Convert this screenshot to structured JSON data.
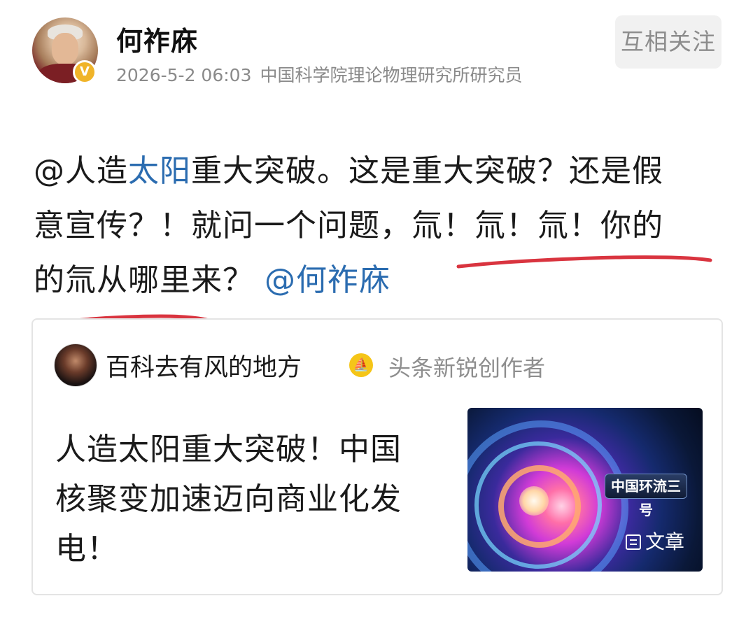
{
  "post": {
    "author_name": "何祚庥",
    "verified_badge": "V",
    "timestamp": "2026-5-2 06:03",
    "author_title": "中国科学院理论物理研究所研究员",
    "follow_label": "互相关注",
    "text": {
      "line1_prefix": "@人造",
      "line1_link": "太阳",
      "line1_suffix": "重大突破。这是重大突破？还是假",
      "line2": "意宣传？！就问一个问题，氚！氚！氚！你的",
      "line3_text": "的氚从哪里来？",
      "line3_mention": "@何祚庥"
    },
    "annotation_color": "#d9343f"
  },
  "repost": {
    "author_name": "百科去有风的地方",
    "creator_badge_icon": "sail-icon",
    "creator_title": "头条新锐创作者",
    "title_line1": "人造太阳重大突破！中国",
    "title_line2": "核聚变加速迈向商业化发",
    "title_line3": "电！",
    "thumbnail_caption": "中国环流三号",
    "type_label": "文章"
  },
  "colors": {
    "link": "#2b6cb0",
    "meta_text": "#8a8a8a",
    "verified_badge": "#f0b429",
    "creator_badge": "#f5c518",
    "follow_bg": "#f1f1f1"
  }
}
